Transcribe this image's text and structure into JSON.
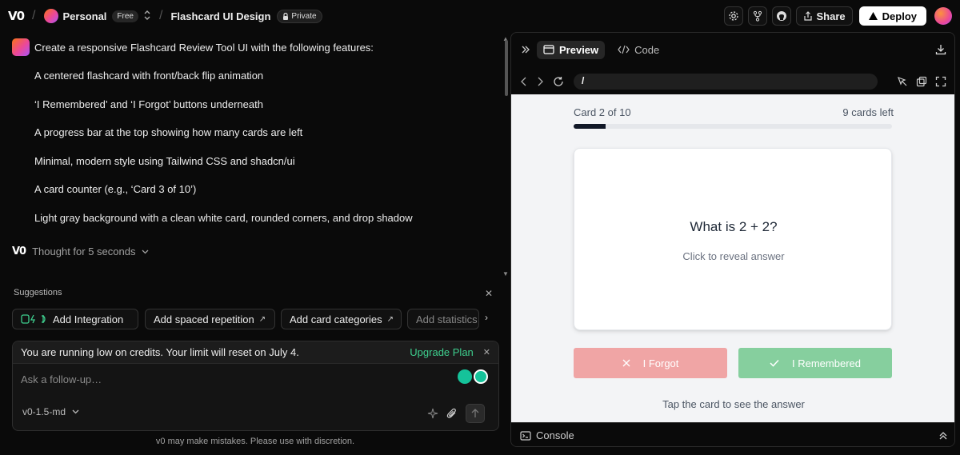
{
  "topbar": {
    "logo": "V0",
    "workspace": "Personal",
    "plan_badge": "Free",
    "project": "Flashcard UI Design",
    "visibility": "Private",
    "share_label": "Share",
    "deploy_label": "Deploy"
  },
  "chat": {
    "prompt_lines": [
      "Create a responsive Flashcard Review Tool UI with the following features:",
      "A centered flashcard with front/back flip animation",
      "‘I Remembered’ and ‘I Forgot’ buttons underneath",
      "A progress bar at the top showing how many cards are left",
      "Minimal, modern style using Tailwind CSS and shadcn/ui",
      "A card counter (e.g., ‘Card 3 of 10’)",
      "Light gray background with a clean white card, rounded corners, and drop shadow"
    ],
    "thought": "Thought for 5 seconds"
  },
  "suggestions": {
    "title": "Suggestions",
    "chips": [
      "Add Integration",
      "Add spaced repetition",
      "Add card categories",
      "Add statistics"
    ]
  },
  "composer": {
    "credits_msg": "You are running low on credits. Your limit will reset on July 4.",
    "upgrade_label": "Upgrade Plan",
    "placeholder": "Ask a follow-up…",
    "model": "v0-1.5-md"
  },
  "disclaimer": "v0 may make mistakes. Please use with discretion.",
  "preview_panel": {
    "tab_preview": "Preview",
    "tab_code": "Code",
    "url": "/",
    "console_label": "Console"
  },
  "flashcard": {
    "counter": "Card 2 of 10",
    "cards_left": "9 cards left",
    "progress_fraction": 0.1,
    "question": "What is 2 + 2?",
    "hint": "Click to reveal answer",
    "forgot_label": "I Forgot",
    "remembered_label": "I Remembered",
    "footer_hint": "Tap the card to see the answer"
  },
  "colors": {
    "accent_green": "#3ecf8e",
    "forgot_bg": "#f0a5a5",
    "remembered_bg": "#86cf9e",
    "preview_bg": "#f3f4f6"
  }
}
